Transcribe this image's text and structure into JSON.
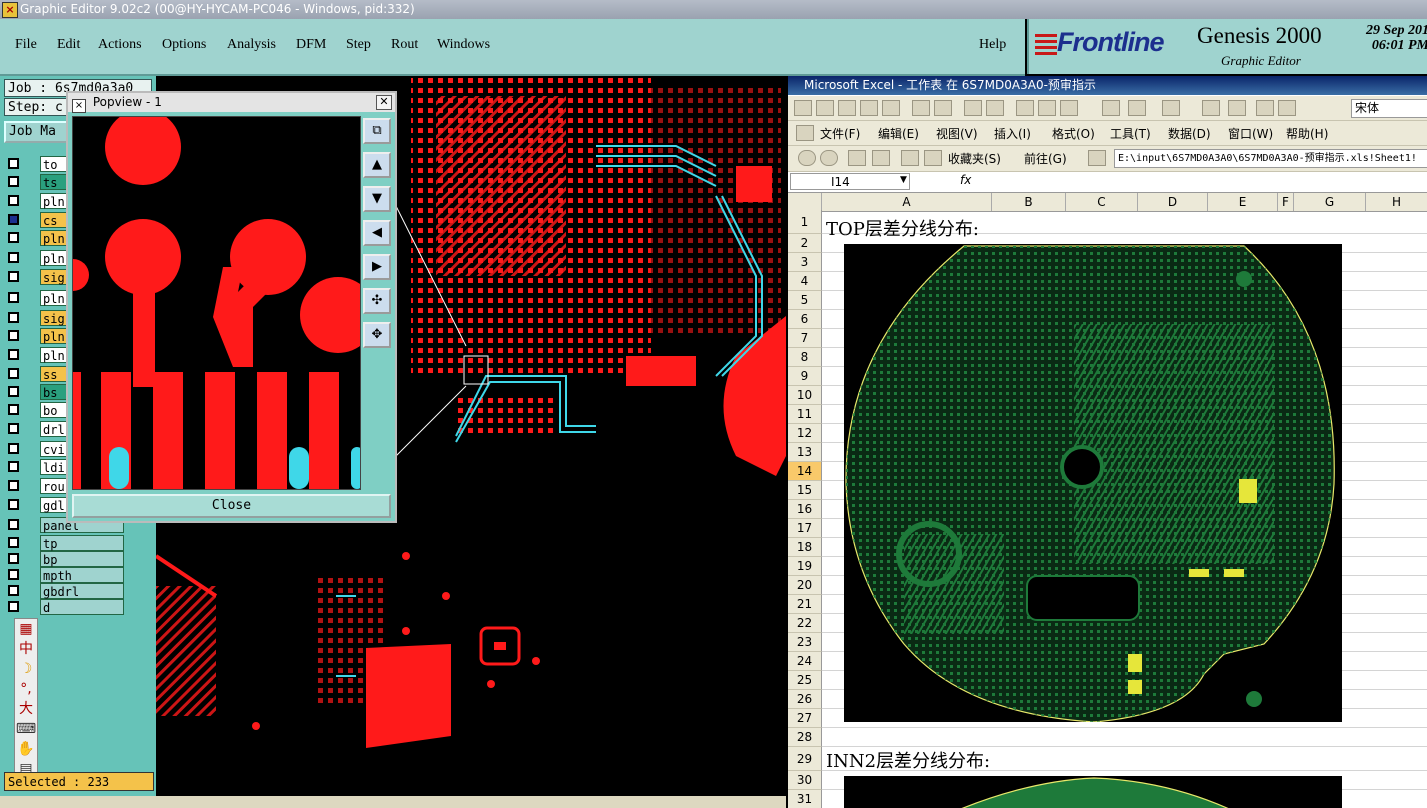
{
  "window": {
    "title": "Graphic Editor 9.02c2 (00@HY-HYCAM-PC046 - Windows, pid:332)"
  },
  "menu": [
    "File",
    "Edit",
    "Actions",
    "Options",
    "Analysis",
    "DFM",
    "Step",
    "Rout",
    "Windows"
  ],
  "help_label": "Help",
  "brand": {
    "logo": "Frontline",
    "product": "Genesis 2000",
    "subtitle": "Graphic Editor",
    "date": "29 Sep 201",
    "time": "06:01 PM"
  },
  "left_panel": {
    "job": "Job : 6s7md0a3a0",
    "step": "Step: c",
    "job_matrix": "Job Ma",
    "layers": [
      "to",
      "ts",
      "pln",
      "cs",
      "pln",
      "pln",
      "sig",
      "pln",
      "sig",
      "pln",
      "pln",
      "ss",
      "bs",
      "bo",
      "drl",
      "cvi",
      "ldi",
      "rou",
      "gdl",
      "panel",
      "tp",
      "bp",
      "mpth",
      "gbdrl",
      "d"
    ],
    "selected": "Selected : 233"
  },
  "ime_chars": [
    "中",
    "°,",
    "大"
  ],
  "popview": {
    "title": "Popview - 1",
    "close_label": "Close"
  },
  "excel": {
    "title": "Microsoft Excel - 工作表 在 6S7MD0A3A0-预审指示",
    "menu": [
      "文件(F)",
      "编辑(E)",
      "视图(V)",
      "插入(I)",
      "格式(O)",
      "工具(T)",
      "数据(D)",
      "窗口(W)",
      "帮助(H)"
    ],
    "font_name": "宋体",
    "favorites": "收藏夹(S)",
    "goto": "前往(G)",
    "path": "E:\\input\\6S7MD0A3A0\\6S7MD0A3A0-预审指示.xls!Sheet1!",
    "name_box": "I14",
    "fx": "fx",
    "columns": [
      "A",
      "B",
      "C",
      "D",
      "E",
      "F",
      "G",
      "H"
    ],
    "rows": [
      "1",
      "2",
      "3",
      "4",
      "5",
      "6",
      "7",
      "8",
      "9",
      "10",
      "11",
      "12",
      "13",
      "14",
      "15",
      "16",
      "17",
      "18",
      "19",
      "20",
      "21",
      "22",
      "23",
      "24",
      "25",
      "26",
      "27",
      "28",
      "29",
      "30",
      "31"
    ],
    "selected_row": "14",
    "heading1": "TOP层差分线分布:",
    "heading2": "INN2层差分线分布:"
  },
  "colors": {
    "trace_red": "#ff1a1a",
    "diff_cyan": "#3fd7e8",
    "pcb_green": "#1e7a3a",
    "panel_teal": "#66c3b8",
    "menubar": "#9fd3cf"
  }
}
